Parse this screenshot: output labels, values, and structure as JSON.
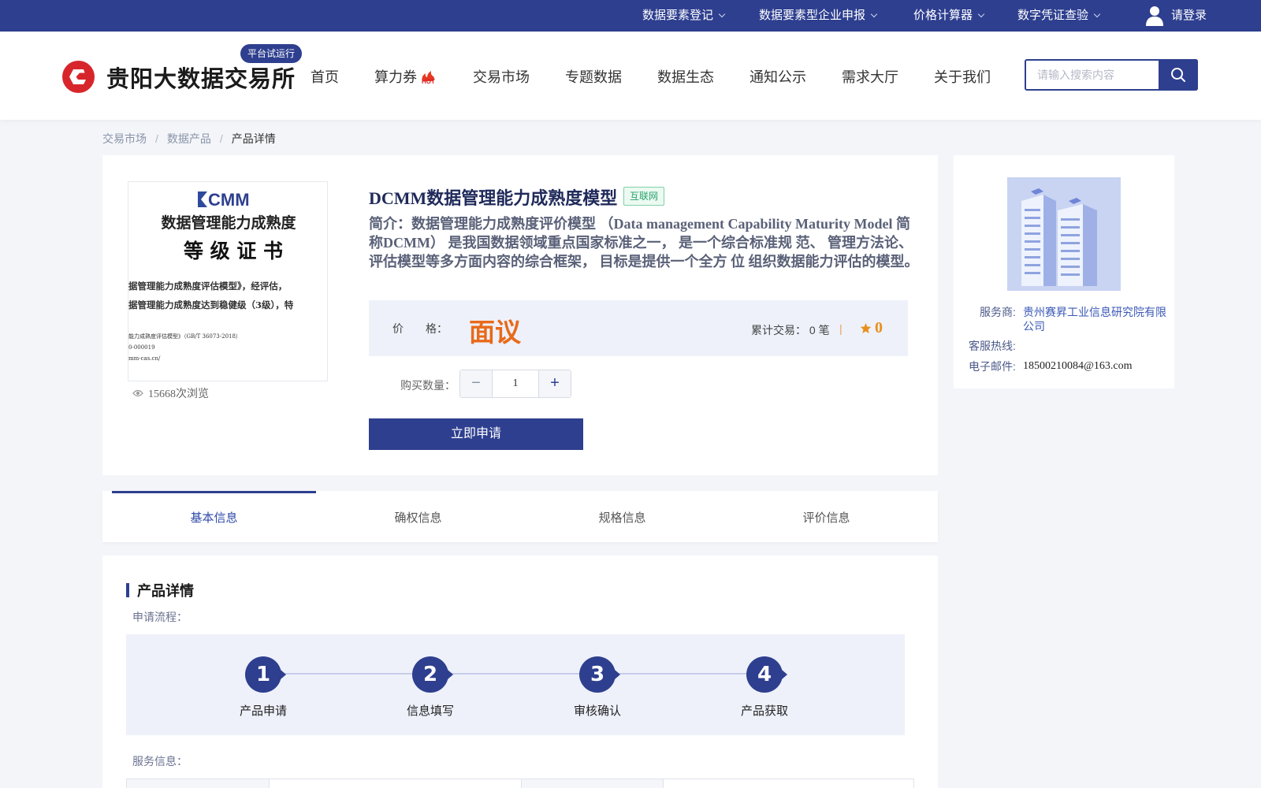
{
  "topbar": {
    "items": [
      {
        "label": "数据要素登记"
      },
      {
        "label": "数据要素型企业申报"
      },
      {
        "label": "价格计算器"
      },
      {
        "label": "数字凭证查验"
      }
    ],
    "login_label": "请登录"
  },
  "header": {
    "site_name": "贵阳大数据交易所",
    "trial_badge": "平台试运行",
    "nav": [
      {
        "label": "首页"
      },
      {
        "label": "算力券",
        "badge": "HOT"
      },
      {
        "label": "交易市场"
      },
      {
        "label": "专题数据"
      },
      {
        "label": "数据生态"
      },
      {
        "label": "通知公示"
      },
      {
        "label": "需求大厅"
      },
      {
        "label": "关于我们"
      }
    ],
    "search": {
      "placeholder": "请输入搜索内容",
      "value": ""
    }
  },
  "breadcrumb": [
    {
      "label": "交易市场"
    },
    {
      "label": "数据产品"
    },
    {
      "label": "产品详情"
    }
  ],
  "product": {
    "title": "DCMM数据管理能力成熟度模型",
    "tag": "互联网",
    "intro": "简介：数据管理能力成熟度评价模型 （Data management Capability Maturity Model 简称DCMM） 是我国数据领域重点国家标准之一， 是一个综合标准规 范、 管理方法论、评估模型等多方面内容的综合框架， 目标是提供一个全方 位 组织数据能力评估的模型。",
    "views": "15668次浏览",
    "price_label": "价　　格：",
    "price_value": "面议",
    "trade_label": "累计交易：",
    "trade_value": "0 笔",
    "rating": "0",
    "qty_label": "购买数量：",
    "qty_value": "1",
    "apply_label": "立即申请",
    "certificate": {
      "logo": "CMM",
      "line1": "数据管理能力成熟度",
      "line2": "等 级 证 书",
      "line3": "据管理能力成熟度评估模型》，经评估，",
      "line4": "据管理能力成熟度达到稳健级（3级），特",
      "line5": "能力成熟度评估模型》（GB/T 36073-2018）",
      "line6": "0-000019",
      "line7": "mm-cas.cn/"
    }
  },
  "provider": {
    "service_label": "服务商:",
    "service_value": "贵州赛昇工业信息研究院有限公司",
    "hotline_label": "客服热线:",
    "hotline_value": "",
    "email_label": "电子邮件:",
    "email_value": "18500210084@163.com"
  },
  "tabs": [
    {
      "label": "基本信息",
      "active": true
    },
    {
      "label": "确权信息",
      "active": false
    },
    {
      "label": "规格信息",
      "active": false
    },
    {
      "label": "评价信息",
      "active": false
    }
  ],
  "detail": {
    "section_title": "产品详情",
    "flow_label": "申请流程：",
    "steps": [
      {
        "num": "1",
        "label": "产品申请"
      },
      {
        "num": "2",
        "label": "信息填写"
      },
      {
        "num": "3",
        "label": "审核确认"
      },
      {
        "num": "4",
        "label": "产品获取"
      }
    ],
    "service_label": "服务信息："
  },
  "colors": {
    "primary": "#2e3f8f",
    "price": "#e86a1a",
    "rating": "#e8901a",
    "tag_green": "#2aa36b",
    "logo_red": "#d7262b"
  }
}
